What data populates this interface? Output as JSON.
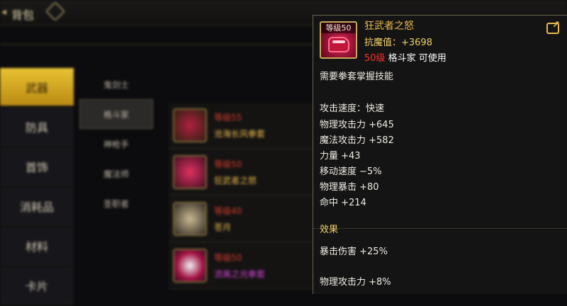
{
  "topbar": {
    "title": "背包"
  },
  "categories": [
    "武器",
    "防具",
    "首饰",
    "消耗品",
    "材料",
    "卡片"
  ],
  "subcategories": [
    "鬼剑士",
    "格斗家",
    "神枪手",
    "魔法师",
    "圣职者"
  ],
  "items": [
    {
      "level": "等级55",
      "name": "沧海长风拳套",
      "badge": "等级55"
    },
    {
      "level": "等级50",
      "name": "狂武者之怒",
      "badge": "等级50"
    },
    {
      "level": "等级40",
      "name": "苍月",
      "badge": "等级40"
    },
    {
      "level": "等级50",
      "name": "流离之光拳套",
      "badge": "等级50"
    }
  ],
  "tooltip": {
    "badge": "等级50",
    "name": "狂武者之怒",
    "resistance": "抗魔值：+3698",
    "req_level": "50级",
    "req_class": " 格斗家 可使用",
    "skill_req": "需要拳套掌握技能",
    "attack_speed": "攻击速度：快速",
    "stats": [
      "物理攻击力 +645",
      "魔法攻击力 +582",
      "力量 +43",
      "移动速度 −5%",
      "物理暴击 +80",
      "命中 +214"
    ],
    "effect_title": "效果",
    "effects": [
      "暴击伤害 +25%",
      "物理攻击力 +8%"
    ]
  }
}
